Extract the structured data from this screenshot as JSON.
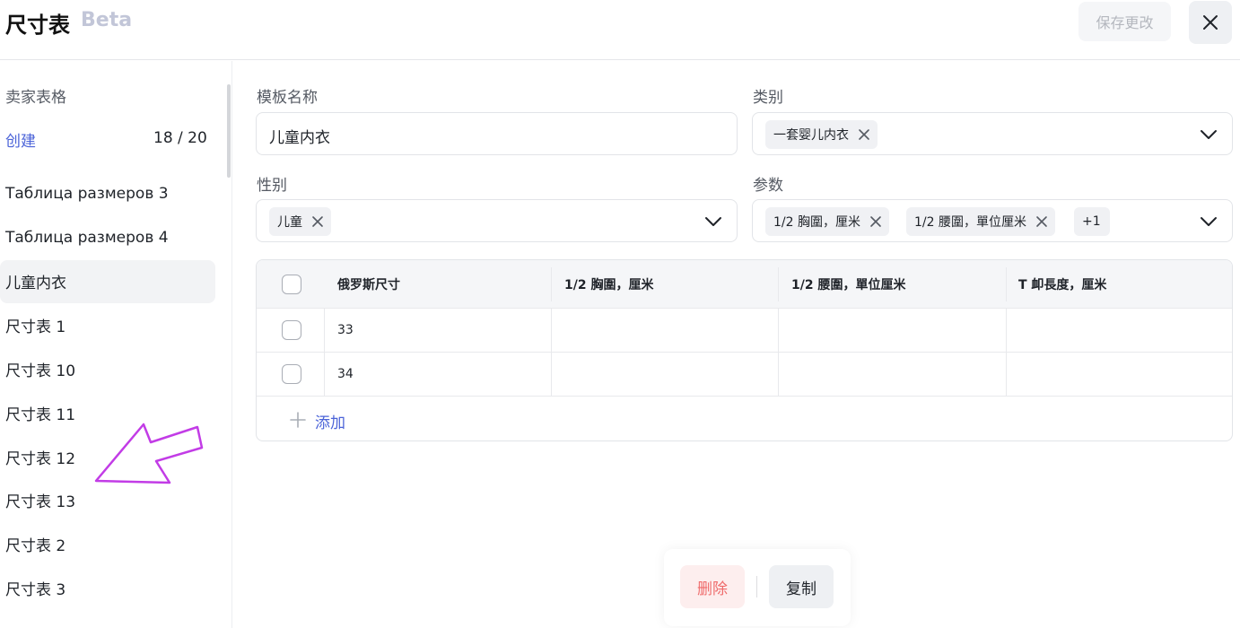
{
  "header": {
    "title": "尺寸表",
    "badge": "Beta",
    "save_label": "保存更改"
  },
  "sidebar": {
    "section_title": "卖家表格",
    "create_label": "创建",
    "count": "18 / 20",
    "items": [
      {
        "label": "Таблица размеров 3",
        "active": false
      },
      {
        "label": "Таблица размеров 4",
        "active": false
      },
      {
        "label": "儿童内衣",
        "active": true
      },
      {
        "label": "尺寸表 1",
        "active": false
      },
      {
        "label": "尺寸表 10",
        "active": false
      },
      {
        "label": "尺寸表 11",
        "active": false
      },
      {
        "label": "尺寸表 12",
        "active": false
      },
      {
        "label": "尺寸表 13",
        "active": false
      },
      {
        "label": "尺寸表 2",
        "active": false
      },
      {
        "label": "尺寸表 3",
        "active": false
      }
    ]
  },
  "form": {
    "template_name_label": "模板名称",
    "template_name_value": "儿童内衣",
    "category_label": "类别",
    "category_chip": "一套婴儿内衣",
    "gender_label": "性别",
    "gender_chip": "儿童",
    "params_label": "参数",
    "params_chips": [
      "1/2 胸圍，厘米",
      "1/2 腰圍，單位厘米"
    ],
    "params_more": "+1"
  },
  "table": {
    "headers": [
      "俄罗斯尺寸",
      "1/2 胸圍，厘米",
      "1/2 腰圍，單位厘米",
      "T 卹長度，厘米"
    ],
    "rows": [
      [
        "33",
        "",
        "",
        ""
      ],
      [
        "34",
        "",
        "",
        ""
      ]
    ],
    "add_label": "添加"
  },
  "footer": {
    "delete_label": "删除",
    "copy_label": "复制"
  },
  "colors": {
    "accent": "#4b63d8",
    "danger": "#ef6b6b",
    "annotation": "#c23ce6"
  }
}
